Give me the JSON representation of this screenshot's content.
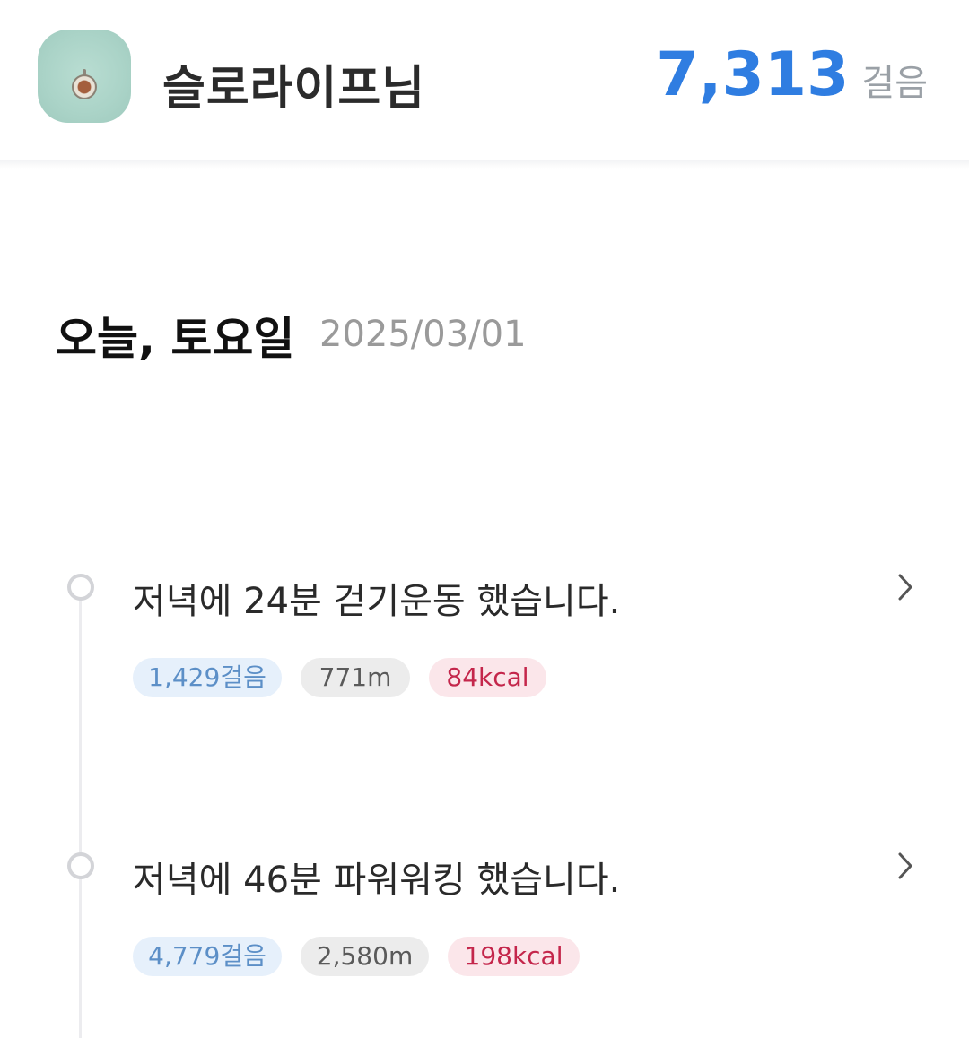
{
  "header": {
    "avatar_icon": "avatar-knob-photo",
    "username": "슬로라이프님",
    "total_steps": "7,313",
    "steps_unit": "걸음",
    "accent_color": "#2f7de1"
  },
  "day": {
    "title": "오늘, 토요일",
    "date": "2025/03/01"
  },
  "activities": [
    {
      "title": "저녁에 24분 걷기운동 했습니다.",
      "steps": "1,429걸음",
      "distance": "771m",
      "calories": "84kcal",
      "chevron_icon": "chevron-right-icon"
    },
    {
      "title": "저녁에 46분 파워워킹 했습니다.",
      "steps": "4,779걸음",
      "distance": "2,580m",
      "calories": "198kcal",
      "chevron_icon": "chevron-right-icon"
    }
  ]
}
